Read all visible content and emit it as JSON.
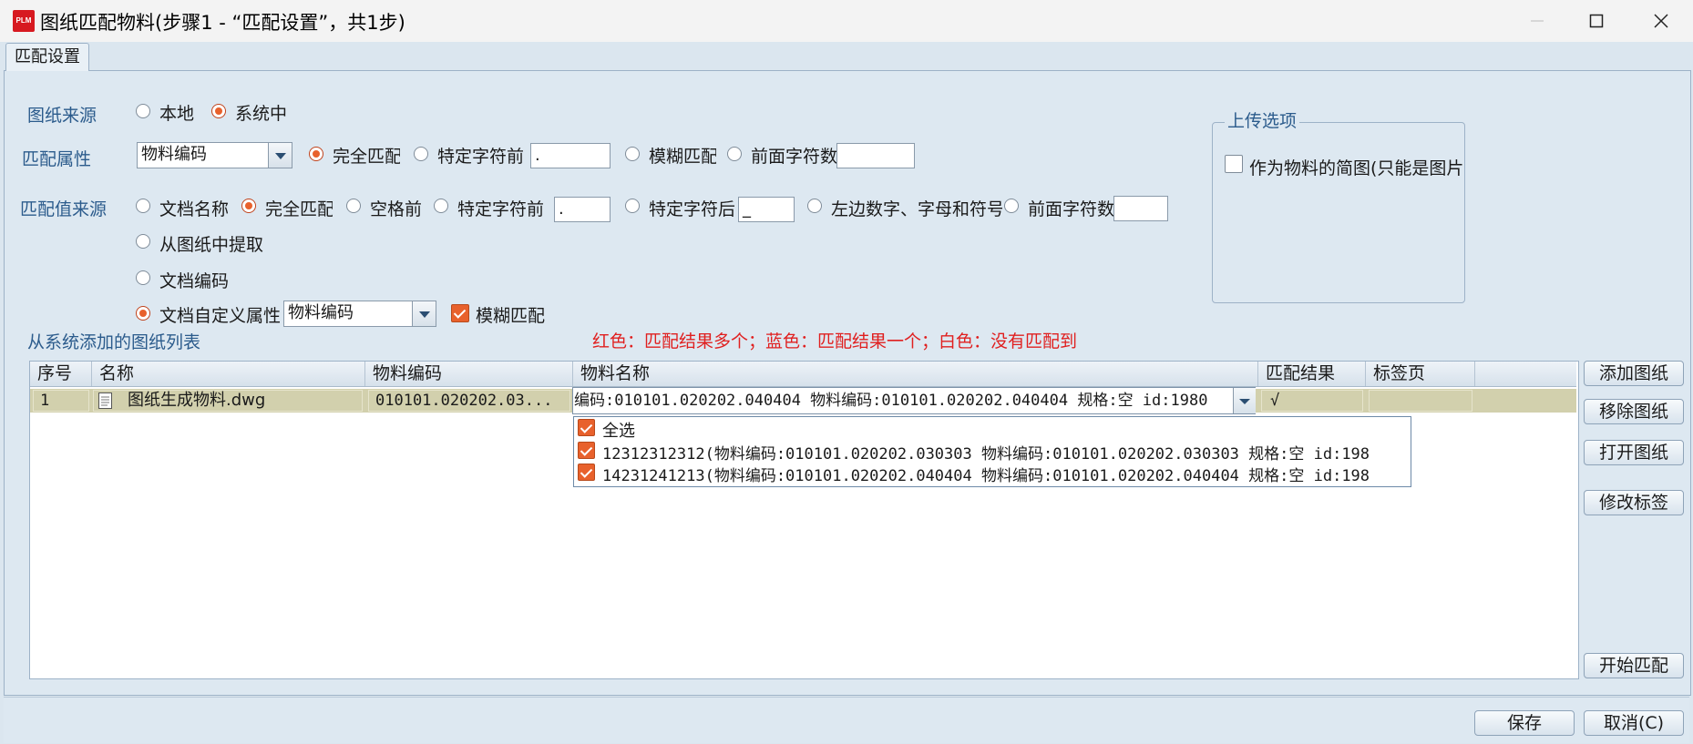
{
  "window": {
    "logo_text": "PLM",
    "title": "图纸匹配物料(步骤1 - “匹配设置”，共1步)"
  },
  "tabs": [
    {
      "label": "匹配设置"
    }
  ],
  "drawing_source": {
    "label": "图纸来源",
    "options": [
      {
        "label": "本地",
        "selected": false
      },
      {
        "label": "系统中",
        "selected": true
      }
    ]
  },
  "match_attr": {
    "label": "匹配属性",
    "combo_value": "物料编码",
    "opt_exact": "完全匹配",
    "opt_before_char": "特定字符前",
    "before_char_value": ".",
    "opt_fuzzy": "模糊匹配",
    "opt_prefix_count": "前面字符数",
    "prefix_count_value": "",
    "selected": "完全匹配"
  },
  "match_value_source": {
    "label": "匹配值来源",
    "opt_doc_name": "文档名称",
    "opt_exact": "完全匹配",
    "opt_before_space": "空格前",
    "opt_before_char": "特定字符前",
    "before_char_value": ".",
    "opt_after_char": "特定字符后",
    "after_char_value": "_",
    "opt_left_chars": "左边数字、字母和符号",
    "opt_prefix_count": "前面字符数",
    "prefix_count_value": "",
    "opt_from_drawing": "从图纸中提取",
    "opt_doc_code": "文档编码",
    "opt_doc_custom_attr": "文档自定义属性",
    "custom_attr_combo": "物料编码",
    "fuzzy_label": "模糊匹配",
    "fuzzy_checked": true,
    "selected_primary": "文档自定义属性",
    "selected_mode": "完全匹配"
  },
  "upload_options": {
    "legend": "上传选项",
    "thumbnail_label": "作为物料的简图(只能是图片",
    "thumbnail_checked": false
  },
  "list": {
    "title": "从系统添加的图纸列表",
    "legend_note": "红色：匹配结果多个；蓝色：匹配结果一个；白色：没有匹配到",
    "columns": [
      "序号",
      "名称",
      "物料编码",
      "物料名称",
      "匹配结果",
      "标签页"
    ],
    "rows": [
      {
        "index": "1",
        "name": "图纸生成物料.dwg",
        "material_code": "010101.020202.03...",
        "material_name": "编码:010101.020202.040404 物料编码:010101.020202.040404 规格:空 id:1980",
        "result": "√",
        "tab": ""
      }
    ],
    "dropdown": {
      "select_all": "全选",
      "items": [
        "12312312312(物料编码:010101.020202.030303 物料编码:010101.020202.030303 规格:空 id:198",
        "14231241213(物料编码:010101.020202.040404 物料编码:010101.020202.040404 规格:空 id:198"
      ]
    }
  },
  "side_buttons": {
    "add": "添加图纸",
    "remove": "移除图纸",
    "open": "打开图纸",
    "edit_tag": "修改标签",
    "start": "开始匹配"
  },
  "footer": {
    "save": "保存",
    "cancel": "取消(C)"
  },
  "colors": {
    "accent": "#e8612c",
    "label_blue": "#2b5b8c",
    "row_highlight": "#d2d0ad",
    "note_red": "#e01f1f"
  }
}
